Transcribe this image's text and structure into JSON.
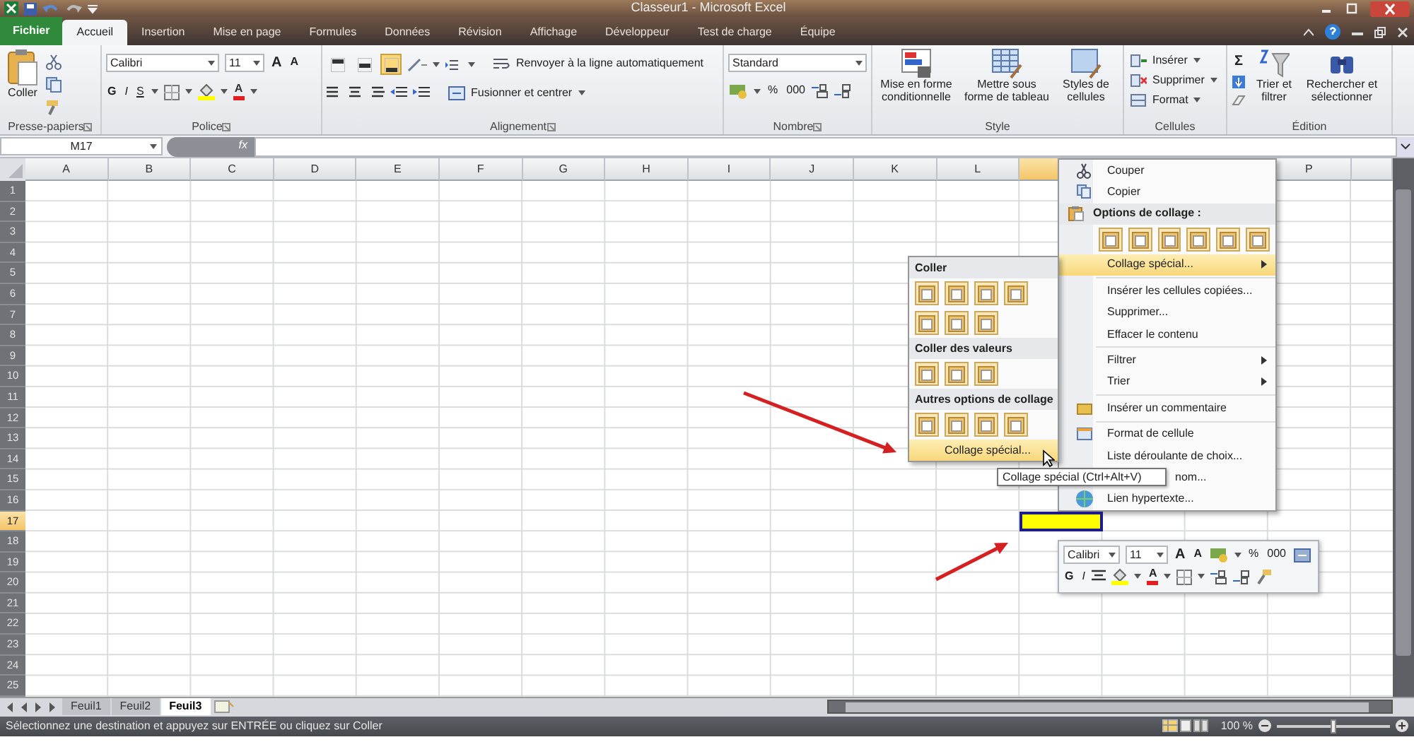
{
  "window": {
    "title": "Classeur1 - Microsoft Excel"
  },
  "ribbon_tabs": [
    {
      "label": "Fichier",
      "kind": "file"
    },
    {
      "label": "Accueil",
      "kind": "tab",
      "selected": true
    },
    {
      "label": "Insertion",
      "kind": "tab",
      "selected": false
    },
    {
      "label": "Mise en page",
      "kind": "tab",
      "selected": false
    },
    {
      "label": "Formules",
      "kind": "tab",
      "selected": false
    },
    {
      "label": "Données",
      "kind": "tab",
      "selected": false
    },
    {
      "label": "Révision",
      "kind": "tab",
      "selected": false
    },
    {
      "label": "Affichage",
      "kind": "tab",
      "selected": false
    },
    {
      "label": "Développeur",
      "kind": "tab",
      "selected": false
    },
    {
      "label": "Test de charge",
      "kind": "tab",
      "selected": false
    },
    {
      "label": "Équipe",
      "kind": "tab",
      "selected": false
    }
  ],
  "ribbon": {
    "clipboard": {
      "paste": "Coller",
      "group": "Presse-papiers"
    },
    "font": {
      "name": "Calibri",
      "size": "11",
      "grow": "A",
      "shrink": "A",
      "bold": "G",
      "italic": "I",
      "underline": "S",
      "text_color_button": "A",
      "group": "Police"
    },
    "alignment": {
      "vertical": [
        {
          "selected": false
        },
        {
          "selected": false
        },
        {
          "selected": true
        }
      ],
      "wrap": "Renvoyer à la ligne automatiquement",
      "merge": "Fusionner et centrer",
      "group": "Alignement"
    },
    "number": {
      "format": "Standard",
      "percent": "%",
      "thousands": "000",
      "group": "Nombre"
    },
    "style": {
      "buttons": [
        {
          "label": "Mise en forme conditionnelle"
        },
        {
          "label": "Mettre sous forme de tableau"
        },
        {
          "label": "Styles de cellules"
        }
      ],
      "group": "Style"
    },
    "cells": {
      "buttons": [
        "Insérer",
        "Supprimer",
        "Format"
      ],
      "group": "Cellules"
    },
    "editing": {
      "sum": "Σ",
      "buttons": [
        {
          "label": "Trier et filtrer"
        },
        {
          "label": "Rechercher et sélectionner"
        }
      ],
      "group": "Édition"
    }
  },
  "formula_bar": {
    "name_box": "M17",
    "fx": "fx"
  },
  "columns": [
    {
      "label": "A",
      "selected": false
    },
    {
      "label": "B",
      "selected": false
    },
    {
      "label": "C",
      "selected": false
    },
    {
      "label": "D",
      "selected": false
    },
    {
      "label": "E",
      "selected": false
    },
    {
      "label": "F",
      "selected": false
    },
    {
      "label": "G",
      "selected": false
    },
    {
      "label": "H",
      "selected": false
    },
    {
      "label": "I",
      "selected": false
    },
    {
      "label": "J",
      "selected": false
    },
    {
      "label": "K",
      "selected": false
    },
    {
      "label": "L",
      "selected": false
    },
    {
      "selected": true
    },
    {
      "label": "P",
      "selected": false
    }
  ],
  "rows": [
    {
      "label": "1",
      "selected": false
    },
    {
      "label": "2",
      "selected": false
    },
    {
      "label": "3",
      "selected": false
    },
    {
      "label": "4",
      "selected": false
    },
    {
      "label": "5",
      "selected": false
    },
    {
      "label": "6",
      "selected": false
    },
    {
      "label": "7",
      "selected": false
    },
    {
      "label": "8",
      "selected": false
    },
    {
      "label": "9",
      "selected": false
    },
    {
      "label": "10",
      "selected": false
    },
    {
      "label": "11",
      "selected": false
    },
    {
      "label": "12",
      "selected": false
    },
    {
      "label": "13",
      "selected": false
    },
    {
      "label": "14",
      "selected": false
    },
    {
      "label": "15",
      "selected": false
    },
    {
      "label": "16",
      "selected": false
    },
    {
      "label": "17",
      "selected": true
    },
    {
      "label": "18",
      "selected": false
    },
    {
      "label": "19",
      "selected": false
    },
    {
      "label": "20",
      "selected": false
    },
    {
      "label": "21",
      "selected": false
    },
    {
      "label": "22",
      "selected": false
    },
    {
      "label": "23",
      "selected": false
    },
    {
      "label": "24",
      "selected": false
    },
    {
      "label": "25",
      "selected": false
    }
  ],
  "context_menu": {
    "items": [
      {
        "kind": "item",
        "label": "Couper",
        "submenu": false,
        "selected": false
      },
      {
        "kind": "item",
        "label": "Copier",
        "submenu": false,
        "selected": false
      },
      {
        "kind": "header",
        "label": "Options de collage :"
      },
      {
        "kind": "icons"
      },
      {
        "kind": "item",
        "label": "Collage spécial...",
        "submenu": true,
        "selected": true
      },
      {
        "kind": "separator"
      },
      {
        "kind": "item",
        "label": "Insérer les cellules copiées...",
        "submenu": false,
        "selected": false
      },
      {
        "kind": "item",
        "label": "Supprimer...",
        "submenu": false,
        "selected": false
      },
      {
        "kind": "item",
        "label": "Effacer le contenu",
        "submenu": false,
        "selected": false
      },
      {
        "kind": "separator"
      },
      {
        "kind": "item",
        "label": "Filtrer",
        "submenu": true,
        "selected": false
      },
      {
        "kind": "item",
        "label": "Trier",
        "submenu": true,
        "selected": false
      },
      {
        "kind": "separator"
      },
      {
        "kind": "item",
        "label": "Insérer un commentaire",
        "submenu": false,
        "selected": false
      },
      {
        "kind": "separator"
      },
      {
        "kind": "item",
        "label": "Format de cellule",
        "submenu": false,
        "selected": false
      },
      {
        "kind": "item",
        "label": "Liste déroulante de choix...",
        "submenu": false,
        "selected": false
      },
      {
        "kind": "covered",
        "label": "nom...",
        "submenu": false,
        "selected": false
      },
      {
        "kind": "item",
        "label": "Lien hypertexte...",
        "submenu": false,
        "selected": false
      }
    ]
  },
  "paste_submenu": {
    "items": [
      {
        "kind": "header",
        "label": "Coller"
      },
      {
        "kind": "icons"
      },
      {
        "kind": "icons"
      },
      {
        "kind": "header",
        "label": "Coller des valeurs"
      },
      {
        "kind": "icons"
      },
      {
        "kind": "header",
        "label": "Autres options de collage"
      },
      {
        "kind": "icons"
      },
      {
        "kind": "item",
        "label": "Collage spécial...",
        "selected": true
      }
    ]
  },
  "tooltip": "Collage spécial (Ctrl+Alt+V)",
  "mini_toolbar": {
    "font": "Calibri",
    "size": "11",
    "grow": "A",
    "shrink": "A",
    "percent": "%",
    "thousands": "000",
    "bold": "G",
    "italic": "I",
    "text_color_button": "A"
  },
  "sheet_tabs": [
    {
      "label": "Feuil1",
      "selected": false
    },
    {
      "label": "Feuil2",
      "selected": false
    },
    {
      "label": "Feuil3",
      "selected": true
    }
  ],
  "status_bar": {
    "message": "Sélectionnez une destination et appuyez sur ENTRÉE ou cliquez sur Coller",
    "zoom": "100 %",
    "zoom_slider": {
      "level": 0.5
    }
  }
}
